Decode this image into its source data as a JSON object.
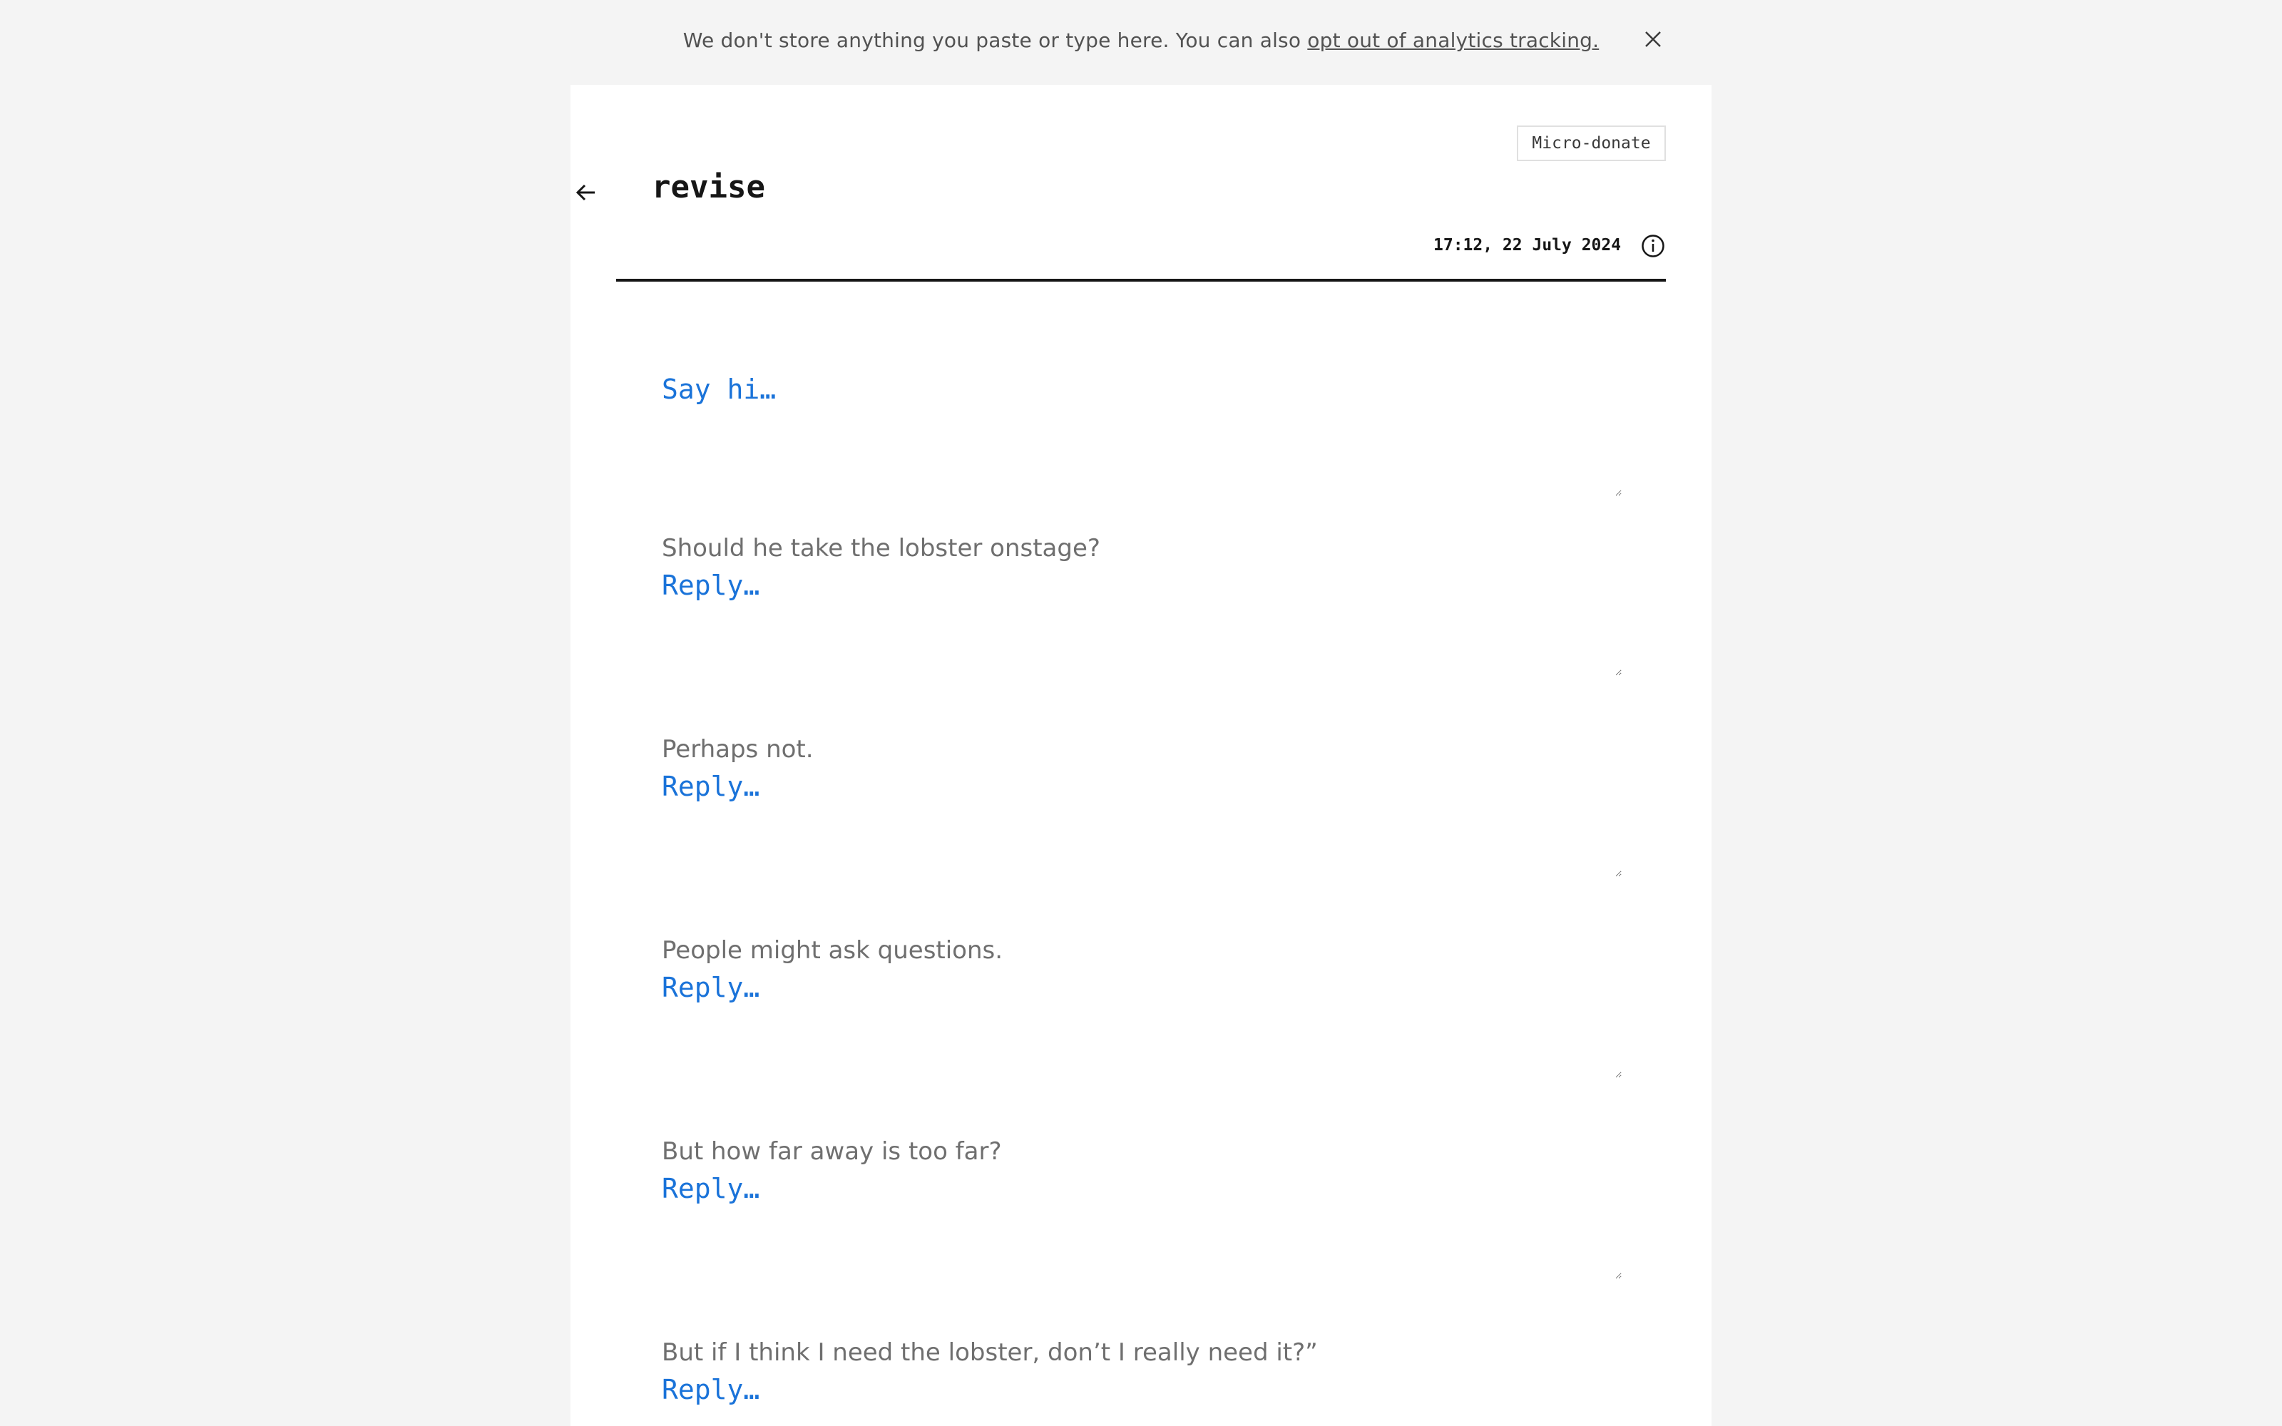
{
  "banner": {
    "text": "We don't store anything you paste or type here. You can also ",
    "link": "opt out of analytics tracking.",
    "close_icon": "close-icon"
  },
  "donate_label": "Micro-donate",
  "header": {
    "back_icon": "arrow-left-icon",
    "title": "revise",
    "timestamp": "17:12, 22 July 2024",
    "info_icon": "info-icon"
  },
  "first": {
    "placeholder": "Say hi…"
  },
  "entries": [
    {
      "prompt": "Should he take the lobster onstage?",
      "placeholder": "Reply…"
    },
    {
      "prompt": "Perhaps not.",
      "placeholder": "Reply…"
    },
    {
      "prompt": "People might ask questions.",
      "placeholder": "Reply…"
    },
    {
      "prompt": "But how far away is too far?",
      "placeholder": "Reply…"
    },
    {
      "prompt": "But if I think I need the lobster, don’t I really need it?”",
      "placeholder": "Reply…"
    }
  ],
  "colors": {
    "accent": "#1a73d9",
    "prompt_text": "#6f6f6f",
    "background": "#f4f4f4"
  }
}
